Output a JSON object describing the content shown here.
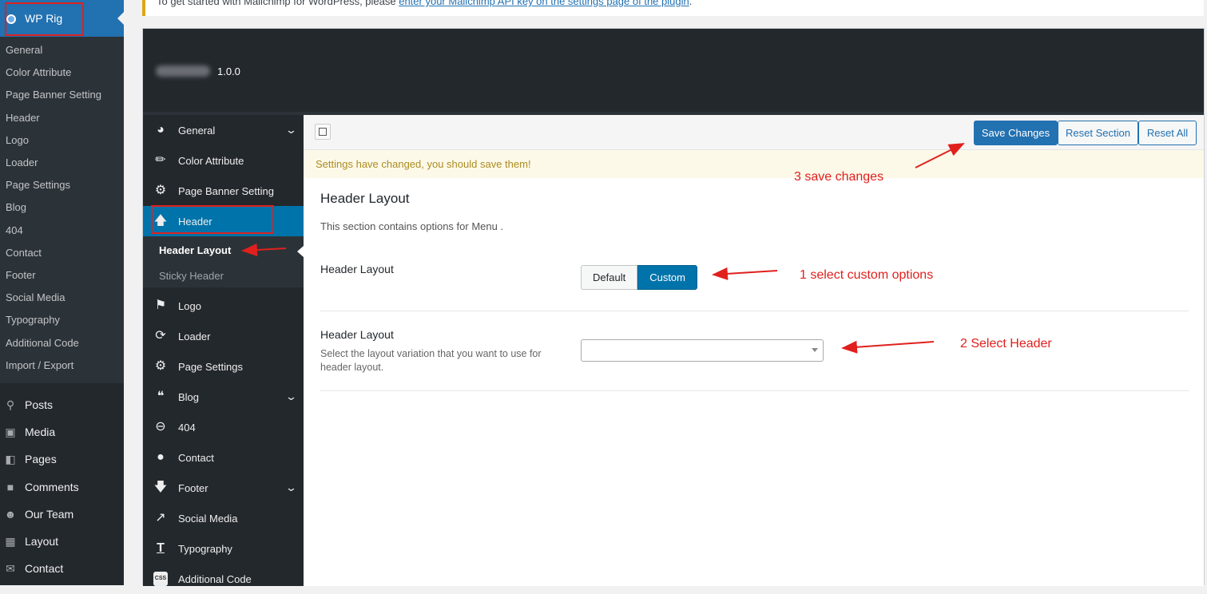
{
  "notice": {
    "text_before": "To get started with Mailchimp for WordPress, please ",
    "link": "enter your Mailchimp API key on the settings page of the plugin",
    "text_after": "."
  },
  "wp_sidebar": {
    "plugin_title": "WP Rig",
    "submenu": [
      "General",
      "Color Attribute",
      "Page Banner Setting",
      "Header",
      "Logo",
      "Loader",
      "Page Settings",
      "Blog",
      "404",
      "Contact",
      "Footer",
      "Social Media",
      "Typography",
      "Additional Code",
      "Import / Export"
    ],
    "menu": [
      {
        "label": "Posts",
        "icon": "pin-icon"
      },
      {
        "label": "Media",
        "icon": "media-icon"
      },
      {
        "label": "Pages",
        "icon": "pages-icon"
      },
      {
        "label": "Comments",
        "icon": "comments-icon"
      },
      {
        "label": "Our Team",
        "icon": "team-icon"
      },
      {
        "label": "Layout",
        "icon": "layout-icon"
      },
      {
        "label": "Contact",
        "icon": "mail-icon"
      }
    ]
  },
  "panel": {
    "version": "1.0.0",
    "nav": [
      {
        "label": "General",
        "icon": "dashboard-icon",
        "chevron": true
      },
      {
        "label": "Color Attribute",
        "icon": "brush-icon"
      },
      {
        "label": "Page Banner Setting",
        "icon": "gear-icon"
      },
      {
        "label": "Header",
        "icon": "arrow-up-icon",
        "active": true
      },
      {
        "label": "Logo",
        "icon": "flag-icon"
      },
      {
        "label": "Loader",
        "icon": "refresh-icon"
      },
      {
        "label": "Page Settings",
        "icon": "gear-icon"
      },
      {
        "label": "Blog",
        "icon": "quote-icon",
        "chevron": true
      },
      {
        "label": "404",
        "icon": "minus-circle-icon"
      },
      {
        "label": "Contact",
        "icon": "location-icon"
      },
      {
        "label": "Footer",
        "icon": "arrow-down-icon",
        "chevron": true
      },
      {
        "label": "Social Media",
        "icon": "share-icon"
      },
      {
        "label": "Typography",
        "icon": "text-icon"
      },
      {
        "label": "Additional Code",
        "icon": "css-icon"
      }
    ],
    "header_sub": [
      "Header Layout",
      "Sticky Header"
    ],
    "toolbar": {
      "save": "Save Changes",
      "reset_section": "Reset Section",
      "reset_all": "Reset All"
    },
    "warning": "Settings have changed, you should save them!",
    "section": {
      "title": "Header Layout",
      "description": "This section contains options for Menu ."
    },
    "fields": {
      "layout_type": {
        "label": "Header Layout",
        "options": [
          "Default",
          "Custom"
        ],
        "selected": "Custom"
      },
      "layout_variation": {
        "label": "Header Layout",
        "description": "Select the layout variation that you want to use for header layout.",
        "value": ""
      }
    }
  },
  "annotations": {
    "step1": "1 select custom options",
    "step2": "2 Select Header",
    "step3": "3 save changes",
    "color": "#e0201d"
  }
}
